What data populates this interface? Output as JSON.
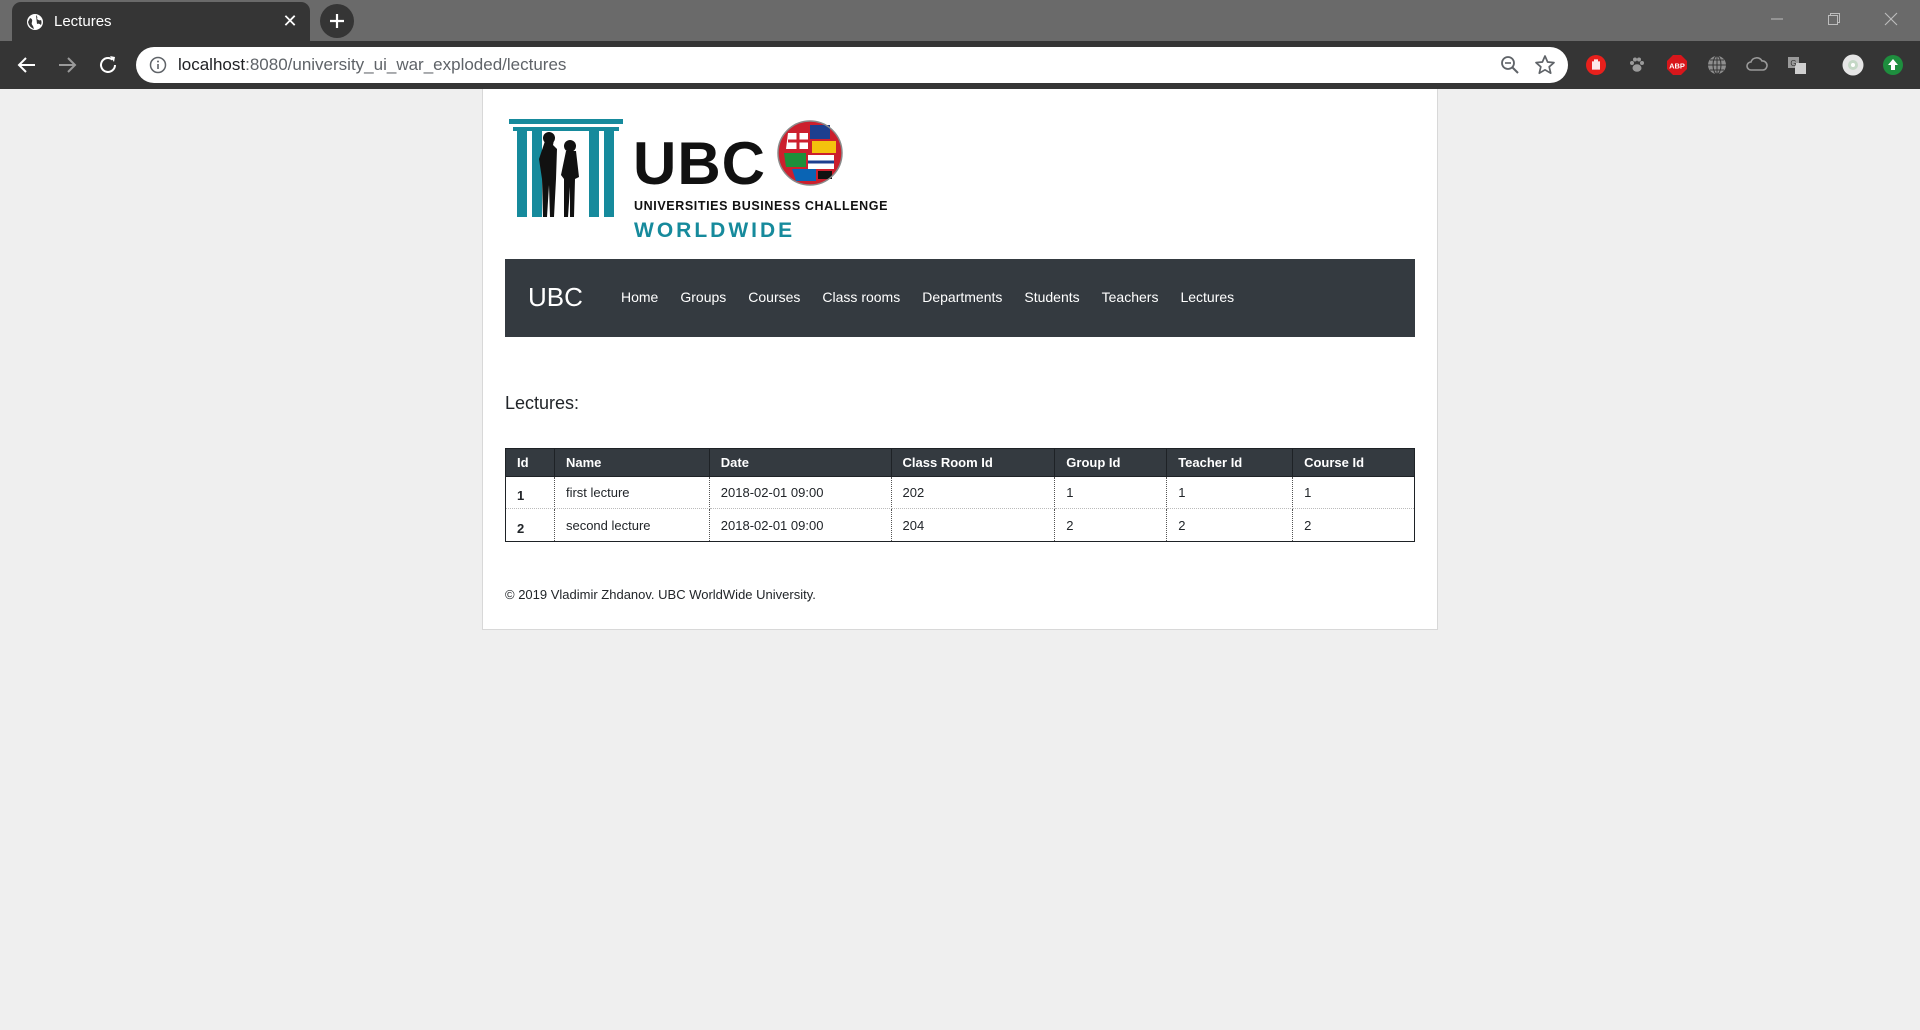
{
  "browser": {
    "tab_title": "Lectures",
    "url_host": "localhost",
    "url_path": ":8080/university_ui_war_exploded/lectures",
    "colors": {
      "frame": "#6a6a6a",
      "toolbar": "#353535"
    }
  },
  "logo": {
    "name": "UBC",
    "subtitle": "UNIVERSITIES BUSINESS CHALLENGE",
    "tagline": "WORLDWIDE",
    "accent_color": "#168a9c"
  },
  "navbar": {
    "brand": "UBC",
    "links": [
      "Home",
      "Groups",
      "Courses",
      "Class rooms",
      "Departments",
      "Students",
      "Teachers",
      "Lectures"
    ],
    "background": "#343a40"
  },
  "page": {
    "heading": "Lectures:"
  },
  "table": {
    "columns": [
      "Id",
      "Name",
      "Date",
      "Class Room Id",
      "Group Id",
      "Teacher Id",
      "Course Id"
    ],
    "rows": [
      [
        "1",
        "first lecture",
        "2018-02-01 09:00",
        "202",
        "1",
        "1",
        "1"
      ],
      [
        "2",
        "second lecture",
        "2018-02-01 09:00",
        "204",
        "2",
        "2",
        "2"
      ]
    ]
  },
  "footer": {
    "text": "© 2019 Vladimir Zhdanov. UBC WorldWide University."
  }
}
